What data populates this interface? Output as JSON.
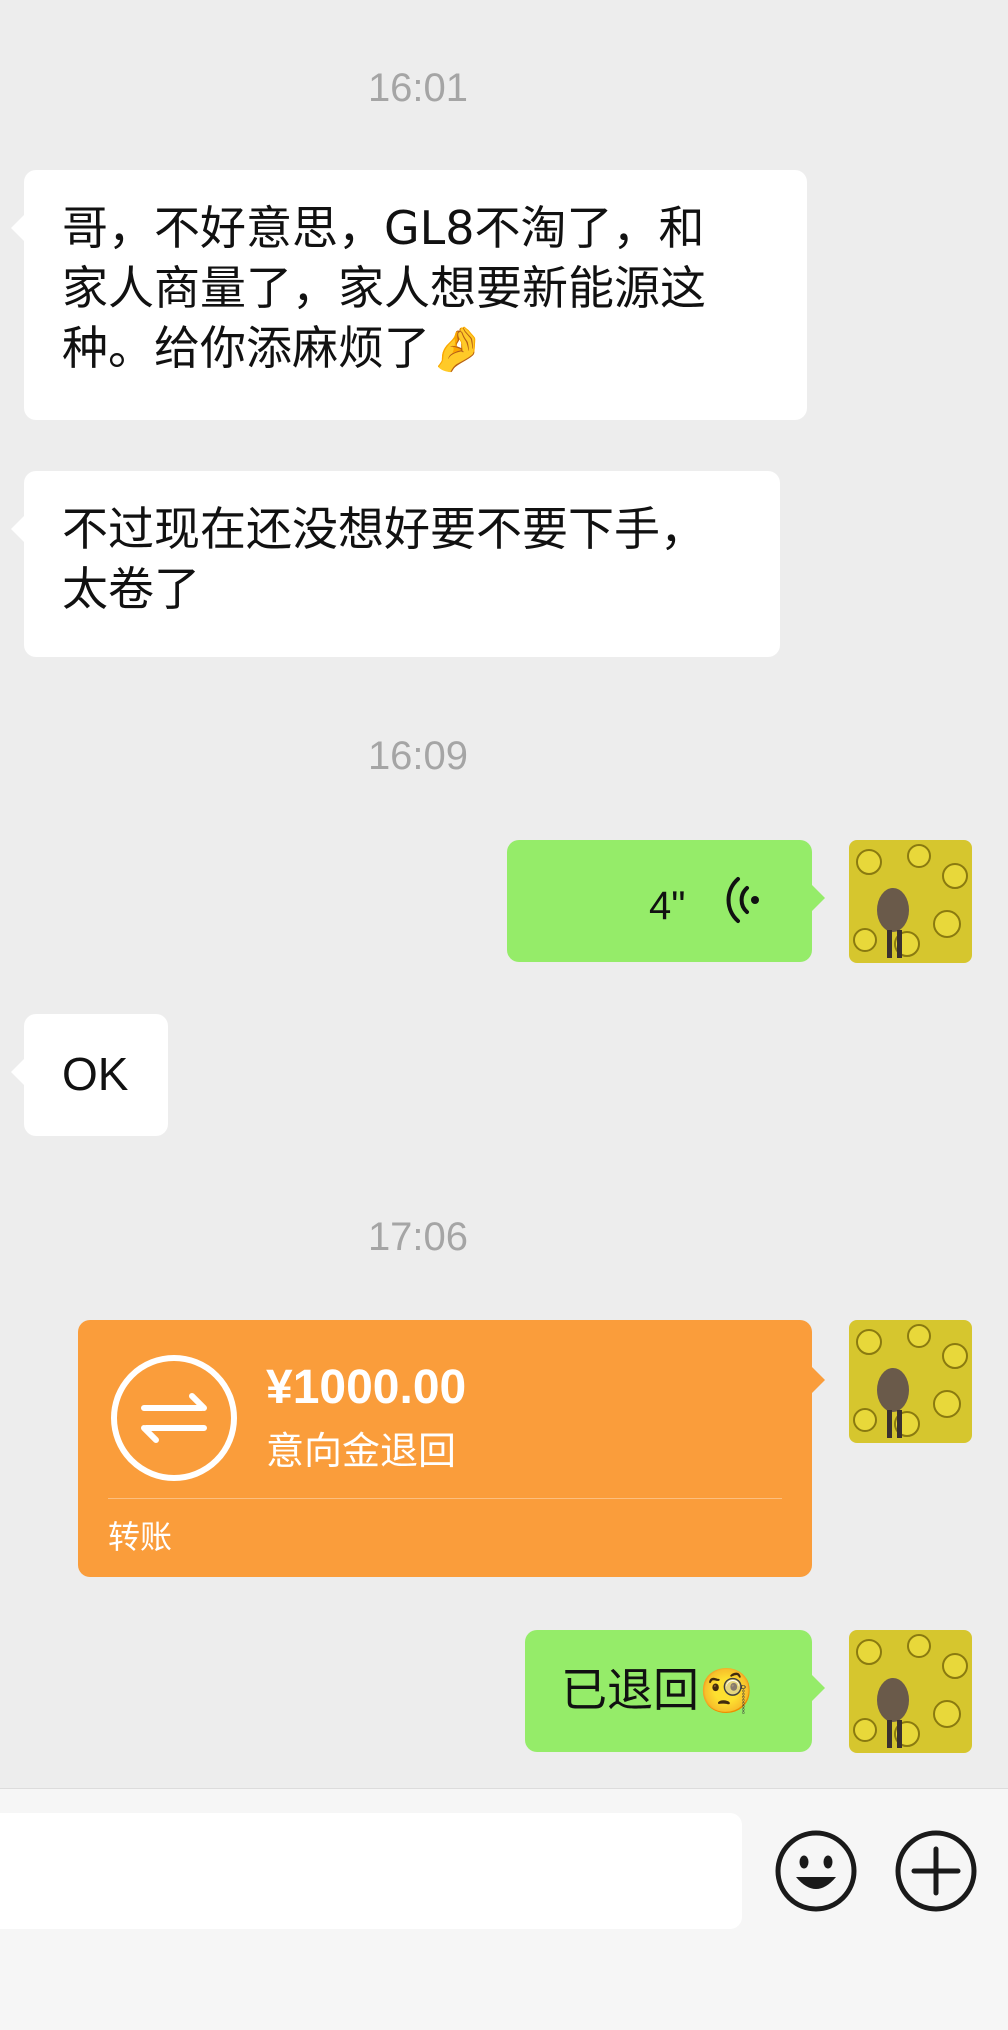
{
  "messages": {
    "ts1": "16:01",
    "in1_line1": "哥，不好意思，GL8不淘了，和",
    "in1_line2": "家人商量了，家人想要新能源这",
    "in1_line3": "种。给你添麻烦了",
    "in1_emoji": "🤌",
    "in2_line1": "不过现在还没想好要不要下手，",
    "in2_line2": "太卷了",
    "ts2": "16:09",
    "voice_duration": "4\"",
    "in3": "OK",
    "ts3": "17:06",
    "transfer": {
      "amount": "¥1000.00",
      "note": "意向金退回",
      "label": "转账"
    },
    "out_text": "已退回",
    "out_emoji": "🧐"
  },
  "colors": {
    "background": "#ededed",
    "incoming_bubble": "#ffffff",
    "outgoing_bubble": "#95ec69",
    "transfer_bubble": "#fa9d3b",
    "timestamp": "#a5a5a5"
  },
  "icons": {
    "voice": "voice-wave-icon",
    "transfer": "transfer-arrows-icon",
    "emoji_button": "smiley-icon",
    "plus_button": "plus-circle-icon"
  }
}
